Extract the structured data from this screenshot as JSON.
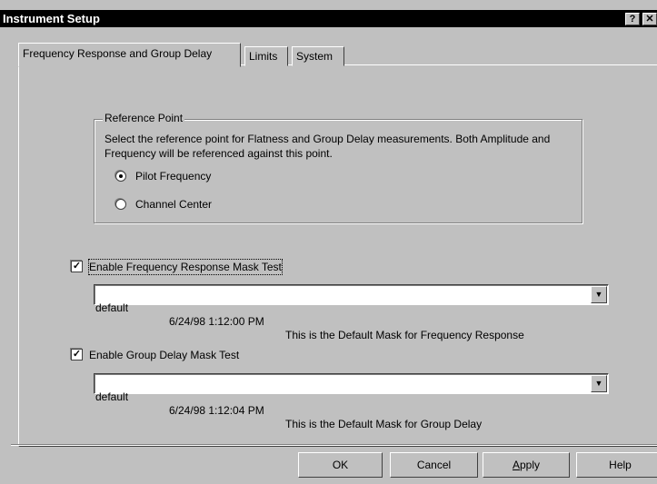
{
  "window": {
    "title": "Instrument Setup",
    "help_glyph": "?",
    "close_glyph": "✕"
  },
  "tabs": [
    {
      "label": "Frequency Response and Group Delay",
      "active": true
    },
    {
      "label": "Limits",
      "active": false
    },
    {
      "label": "System",
      "active": false
    }
  ],
  "reference_point": {
    "legend": "Reference Point",
    "description": "Select the reference point for Flatness and Group Delay measurements. Both Amplitude and Frequency will be referenced against this point.",
    "options": [
      {
        "label": "Pilot Frequency",
        "selected": true
      },
      {
        "label": "Channel Center",
        "selected": false
      }
    ]
  },
  "freq_response_mask": {
    "label": "Enable Frequency Response Mask Test",
    "checked": true,
    "mask_name": "default",
    "mask_date": "6/24/98 1:12:00 PM",
    "mask_desc": "This is the Default Mask for Frequency Response"
  },
  "group_delay_mask": {
    "label": "Enable Group Delay Mask Test",
    "checked": true,
    "mask_name": "default",
    "mask_date": "6/24/98 1:12:04 PM",
    "mask_desc": "This is the Default Mask for Group Delay"
  },
  "check_glyph": "✓",
  "dropdown_glyph": "▼",
  "buttons": {
    "ok": "OK",
    "cancel": "Cancel",
    "apply_underlined": "A",
    "apply_rest": "pply",
    "help": "Help"
  }
}
